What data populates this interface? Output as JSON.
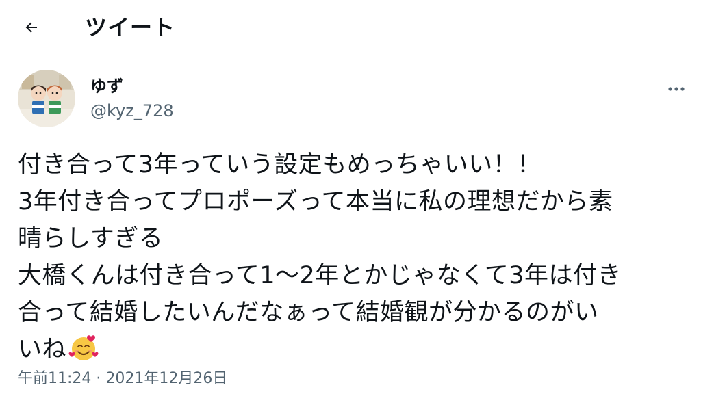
{
  "header": {
    "back_icon": "arrow-left-icon",
    "title": "ツイート"
  },
  "tweet": {
    "author": {
      "display_name": "ゆず",
      "handle": "@kyz_728",
      "avatar_icon": "avatar-image"
    },
    "more_icon": "more-dots-icon",
    "lines": [
      "付き合って3年っていう設定もめっちゃいい！！",
      "3年付き合ってプロポーズって本当に私の理想だから素",
      "晴らしすぎる",
      "大橋くんは付き合って1〜2年とかじゃなくて3年は付き",
      "合って結婚したいんだなぁって結婚観が分かるのがい",
      "いね"
    ],
    "emoji_icon": "smiling-face-with-hearts-icon",
    "time": "午前11:24",
    "separator": "·",
    "date": "2021年12月26日"
  },
  "colors": {
    "text_primary": "#0f1419",
    "text_secondary": "#536471",
    "background": "#ffffff"
  }
}
